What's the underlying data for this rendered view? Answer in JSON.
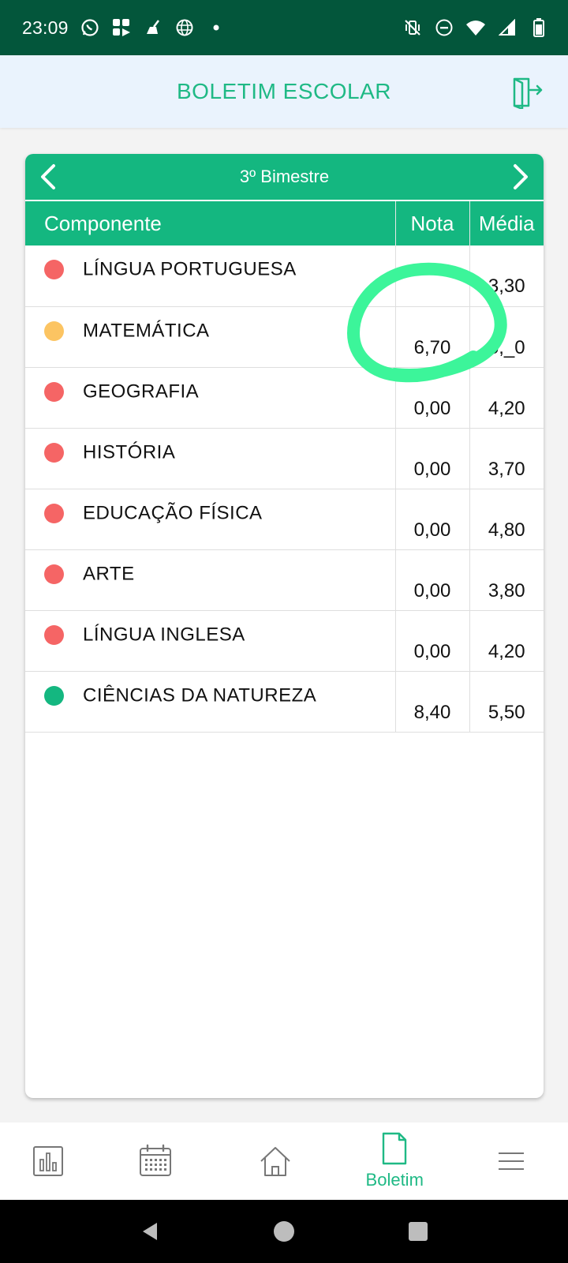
{
  "status_bar": {
    "time": "23:09"
  },
  "header": {
    "title": "BOLETIM ESCOLAR"
  },
  "period": {
    "label": "3º Bimestre"
  },
  "table": {
    "headers": {
      "component": "Componente",
      "grade": "Nota",
      "average": "Média"
    },
    "rows": [
      {
        "subject": "LÍNGUA PORTUGUESA",
        "grade": "",
        "average": "3,30",
        "status": "red"
      },
      {
        "subject": "MATEMÁTICA",
        "grade": "6,70",
        "average": "5,_0",
        "status": "yellow"
      },
      {
        "subject": "GEOGRAFIA",
        "grade": "0,00",
        "average": "4,20",
        "status": "red"
      },
      {
        "subject": "HISTÓRIA",
        "grade": "0,00",
        "average": "3,70",
        "status": "red"
      },
      {
        "subject": "EDUCAÇÃO FÍSICA",
        "grade": "0,00",
        "average": "4,80",
        "status": "red"
      },
      {
        "subject": "ARTE",
        "grade": "0,00",
        "average": "3,80",
        "status": "red"
      },
      {
        "subject": "LÍNGUA INGLESA",
        "grade": "0,00",
        "average": "4,20",
        "status": "red"
      },
      {
        "subject": "CIÊNCIAS DA NATUREZA",
        "grade": "8,40",
        "average": "5,50",
        "status": "green"
      }
    ]
  },
  "status_colors": {
    "red": "#f56565",
    "yellow": "#fcc462",
    "green": "#14b780"
  },
  "bottom_nav": {
    "items": [
      {
        "icon": "bar-chart-icon",
        "label": ""
      },
      {
        "icon": "calendar-icon",
        "label": ""
      },
      {
        "icon": "home-icon",
        "label": ""
      },
      {
        "icon": "document-icon",
        "label": "Boletim",
        "active": true
      },
      {
        "icon": "menu-icon",
        "label": ""
      }
    ]
  },
  "colors": {
    "accent": "#14b780",
    "status_bar": "#03563b",
    "header_bg": "#eaf3fd",
    "annotation": "#3cf59a"
  }
}
